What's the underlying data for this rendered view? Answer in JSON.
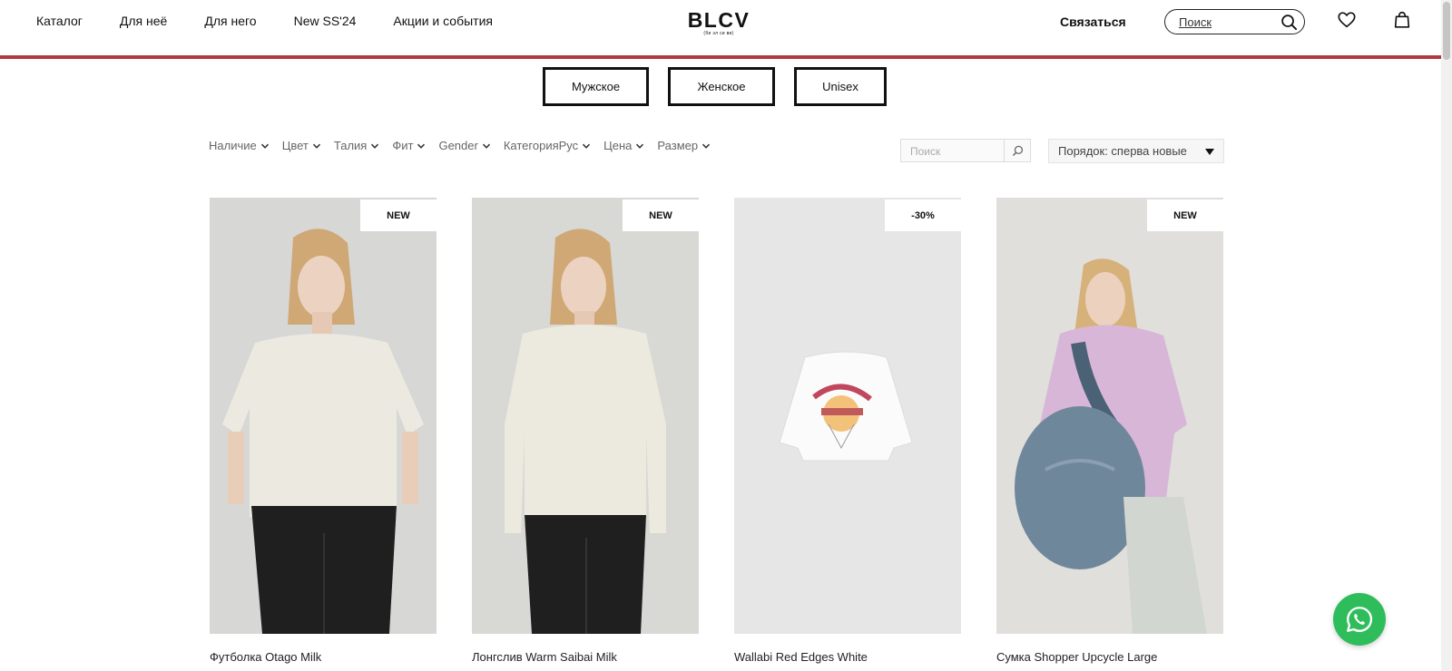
{
  "header": {
    "nav": [
      "Каталог",
      "Для неё",
      "Для него",
      "New SS'24",
      "Акции и события"
    ],
    "logo": "BLCV",
    "logo_sub": "(би эл си ви)",
    "contact": "Связаться",
    "search_placeholder": "Поиск",
    "accent_color": "#b3383f"
  },
  "gender_tabs": [
    "Мужское",
    "Женское",
    "Unisex"
  ],
  "filters": [
    "Наличие",
    "Цвет",
    "Талия",
    "Фит",
    "Gender",
    "КатегорияРус",
    "Цена",
    "Размер"
  ],
  "filter_search_placeholder": "Поиск",
  "sort": {
    "selected": "Порядок: сперва новые"
  },
  "products": [
    {
      "name": "Футболка Otago Milk",
      "badge": "NEW"
    },
    {
      "name": "Лонгслив Warm Saibai Milk",
      "badge": "NEW"
    },
    {
      "name": "Wallabi Red Edges White",
      "badge": "-30%"
    },
    {
      "name": "Сумка Shopper Upcycle Large",
      "badge": "NEW"
    }
  ],
  "icons": {
    "search": "search-icon",
    "wishlist": "heart-icon",
    "cart": "bag-icon",
    "chat": "whatsapp-icon"
  }
}
